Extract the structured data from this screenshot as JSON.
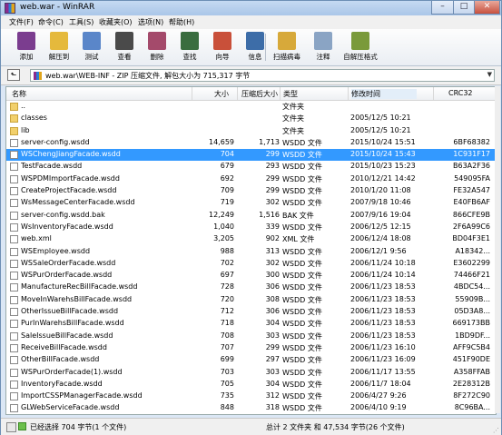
{
  "window": {
    "title": "web.war - WinRAR",
    "controls": [
      "–",
      "□",
      "✕"
    ]
  },
  "menu": [
    "文件(F)",
    "命令(C)",
    "工具(S)",
    "收藏夹(O)",
    "选项(N)",
    "帮助(H)"
  ],
  "toolbar": [
    {
      "label": "添加",
      "icon": "add-archive-icon",
      "color": "#7b3d8f"
    },
    {
      "label": "解压到",
      "icon": "extract-to-icon",
      "color": "#e5b93c"
    },
    {
      "label": "测试",
      "icon": "test-icon",
      "color": "#5a86c9"
    },
    {
      "label": "查看",
      "icon": "view-icon",
      "color": "#4a4a4a"
    },
    {
      "label": "删除",
      "icon": "delete-icon",
      "color": "#a44a6b"
    },
    {
      "label": "查找",
      "icon": "find-icon",
      "color": "#3a6d3f"
    },
    {
      "label": "向导",
      "icon": "wizard-icon",
      "color": "#c9503a"
    },
    {
      "label": "信息",
      "icon": "info-icon",
      "color": "#3d6da8"
    },
    {
      "label": "扫描病毒",
      "icon": "virus-scan-icon",
      "color": "#d7a93a"
    },
    {
      "label": "注释",
      "icon": "comment-icon",
      "color": "#8aa4c4"
    },
    {
      "label": "自解压格式",
      "icon": "sfx-icon",
      "color": "#7a9a3a"
    }
  ],
  "path": {
    "text": "web.war\\WEB-INF - ZIP 压缩文件, 解包大小为 715,317 字节"
  },
  "columns": [
    "名称",
    "大小",
    "压缩后大小",
    "类型",
    "修改时间",
    "CRC32"
  ],
  "files": [
    {
      "name": "..",
      "size": "",
      "packed": "",
      "type": "文件夹",
      "modified": "",
      "crc": "",
      "kind": "folder"
    },
    {
      "name": "classes",
      "size": "",
      "packed": "",
      "type": "文件夹",
      "modified": "2005/12/5 10:21",
      "crc": "",
      "kind": "folder"
    },
    {
      "name": "lib",
      "size": "",
      "packed": "",
      "type": "文件夹",
      "modified": "2005/12/5 10:21",
      "crc": "",
      "kind": "folder"
    },
    {
      "name": "server-config.wsdd",
      "size": "14,659",
      "packed": "1,713",
      "type": "WSDD 文件",
      "modified": "2015/10/24 15:51",
      "crc": "6BF68382",
      "kind": "file"
    },
    {
      "name": "WSChengJiangFacade.wsdd",
      "size": "704",
      "packed": "299",
      "type": "WSDD 文件",
      "modified": "2015/10/24 15:43",
      "crc": "1C931F17",
      "kind": "file",
      "selected": true
    },
    {
      "name": "TestFacade.wsdd",
      "size": "679",
      "packed": "293",
      "type": "WSDD 文件",
      "modified": "2015/10/23 15:23",
      "crc": "B63A2F36",
      "kind": "file"
    },
    {
      "name": "WSPDMImportFacade.wsdd",
      "size": "692",
      "packed": "299",
      "type": "WSDD 文件",
      "modified": "2010/12/21 14:42",
      "crc": "549095FA",
      "kind": "file"
    },
    {
      "name": "CreateProjectFacade.wsdd",
      "size": "709",
      "packed": "299",
      "type": "WSDD 文件",
      "modified": "2010/1/20 11:08",
      "crc": "FE32A547",
      "kind": "file"
    },
    {
      "name": "WsMessageCenterFacade.wsdd",
      "size": "719",
      "packed": "302",
      "type": "WSDD 文件",
      "modified": "2007/9/18 10:46",
      "crc": "E40FB6AF",
      "kind": "file"
    },
    {
      "name": "server-config.wsdd.bak",
      "size": "12,249",
      "packed": "1,516",
      "type": "BAK 文件",
      "modified": "2007/9/16 19:04",
      "crc": "866CFE9B",
      "kind": "file"
    },
    {
      "name": "WsInventoryFacade.wsdd",
      "size": "1,040",
      "packed": "339",
      "type": "WSDD 文件",
      "modified": "2006/12/5 12:15",
      "crc": "2F6A99C6",
      "kind": "file"
    },
    {
      "name": "web.xml",
      "size": "3,205",
      "packed": "902",
      "type": "XML 文件",
      "modified": "2006/12/4 18:08",
      "crc": "BD04F3E1",
      "kind": "file"
    },
    {
      "name": "WSEmployee.wsdd",
      "size": "988",
      "packed": "313",
      "type": "WSDD 文件",
      "modified": "2006/12/1 9:56",
      "crc": "A18342...",
      "kind": "file"
    },
    {
      "name": "WSSaleOrderFacade.wsdd",
      "size": "702",
      "packed": "302",
      "type": "WSDD 文件",
      "modified": "2006/11/24 10:18",
      "crc": "E3602299",
      "kind": "file"
    },
    {
      "name": "WSPurOrderFacade.wsdd",
      "size": "697",
      "packed": "300",
      "type": "WSDD 文件",
      "modified": "2006/11/24 10:14",
      "crc": "74466F21",
      "kind": "file"
    },
    {
      "name": "ManufactureRecBillFacade.wsdd",
      "size": "728",
      "packed": "306",
      "type": "WSDD 文件",
      "modified": "2006/11/23 18:53",
      "crc": "4BDC54...",
      "kind": "file"
    },
    {
      "name": "MoveInWarehsBillFacade.wsdd",
      "size": "720",
      "packed": "308",
      "type": "WSDD 文件",
      "modified": "2006/11/23 18:53",
      "crc": "55909B...",
      "kind": "file"
    },
    {
      "name": "OtherIssueBillFacade.wsdd",
      "size": "712",
      "packed": "306",
      "type": "WSDD 文件",
      "modified": "2006/11/23 18:53",
      "crc": "05D3A8...",
      "kind": "file"
    },
    {
      "name": "PurInWarehsBillFacade.wsdd",
      "size": "718",
      "packed": "304",
      "type": "WSDD 文件",
      "modified": "2006/11/23 18:53",
      "crc": "669173BB",
      "kind": "file"
    },
    {
      "name": "SaleIssueBillFacade.wsdd",
      "size": "708",
      "packed": "303",
      "type": "WSDD 文件",
      "modified": "2006/11/23 18:53",
      "crc": "1BD9DF...",
      "kind": "file"
    },
    {
      "name": "ReceiveBillFacade.wsdd",
      "size": "707",
      "packed": "299",
      "type": "WSDD 文件",
      "modified": "2006/11/23 16:10",
      "crc": "AFF9C5B4",
      "kind": "file"
    },
    {
      "name": "OtherBillFacade.wsdd",
      "size": "699",
      "packed": "297",
      "type": "WSDD 文件",
      "modified": "2006/11/23 16:09",
      "crc": "451F90DE",
      "kind": "file"
    },
    {
      "name": "WSPurOrderFacade(1).wsdd",
      "size": "703",
      "packed": "303",
      "type": "WSDD 文件",
      "modified": "2006/11/17 13:55",
      "crc": "A358FFAB",
      "kind": "file"
    },
    {
      "name": "InventoryFacade.wsdd",
      "size": "705",
      "packed": "304",
      "type": "WSDD 文件",
      "modified": "2006/11/7 18:04",
      "crc": "2E28312B",
      "kind": "file"
    },
    {
      "name": "ImportCSSPManagerFacade.wsdd",
      "size": "735",
      "packed": "312",
      "type": "WSDD 文件",
      "modified": "2006/4/27 9:26",
      "crc": "8F272C90",
      "kind": "file"
    },
    {
      "name": "GLWebServiceFacade.wsdd",
      "size": "848",
      "packed": "318",
      "type": "WSDD 文件",
      "modified": "2006/4/10 9:19",
      "crc": "8C96BA...",
      "kind": "file"
    }
  ],
  "status": {
    "left": "已经选择 704 字节(1 个文件)",
    "right": "总计 2 文件夹 和 47,534 字节(26 个文件)"
  }
}
